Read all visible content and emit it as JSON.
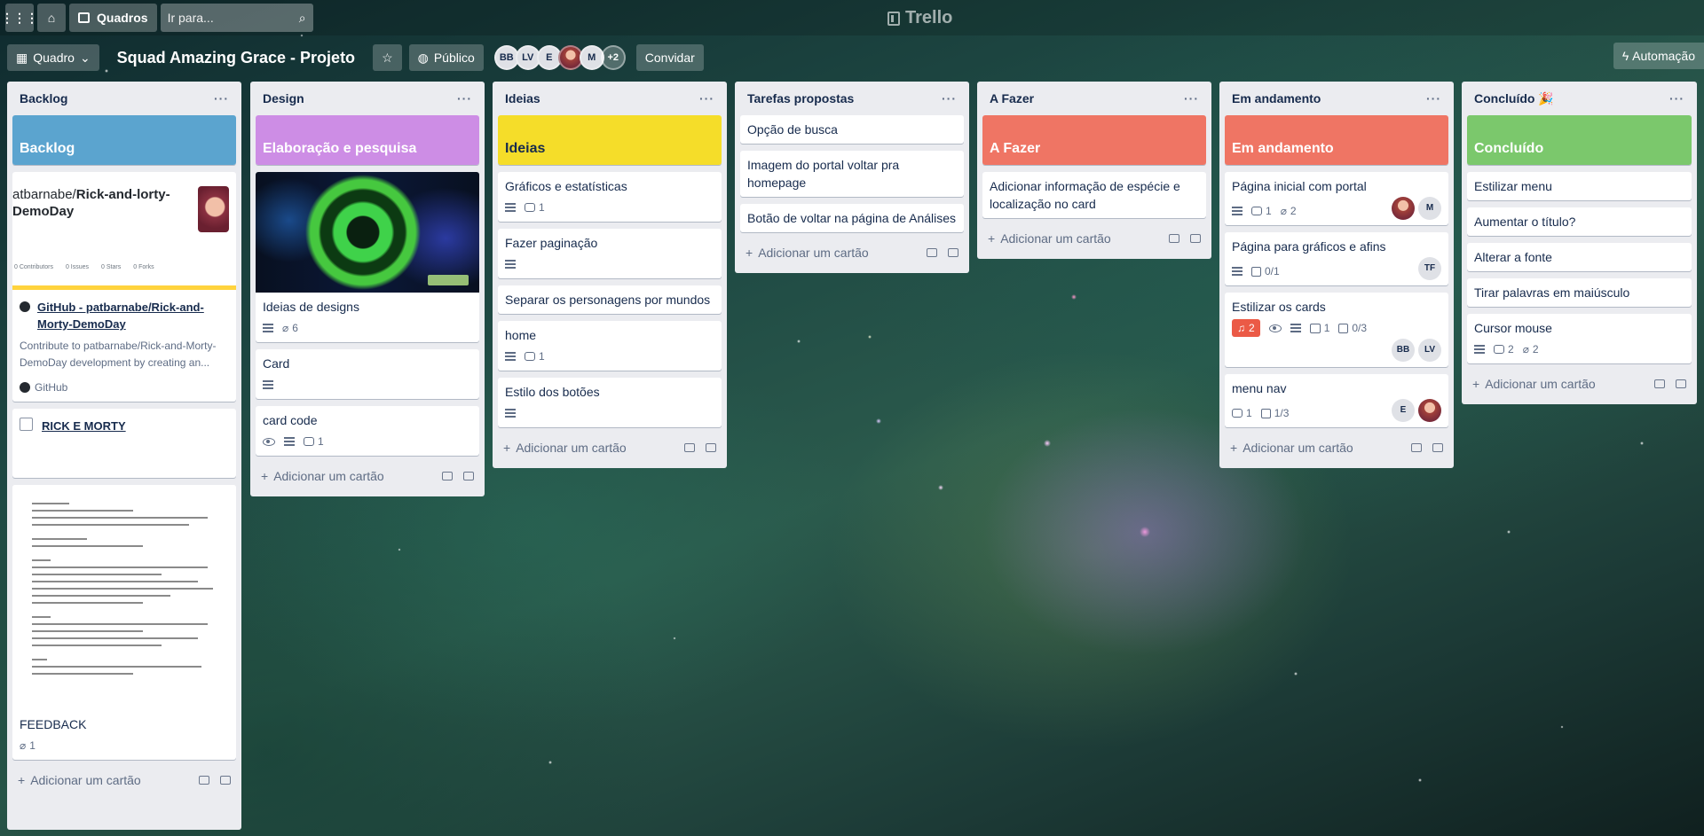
{
  "topnav": {
    "boards_label": "Quadros",
    "search_placeholder": "Ir para...",
    "logo": "Trello"
  },
  "board": {
    "view_label": "Quadro",
    "title": "Squad Amazing Grace - Projeto",
    "visibility": "Público",
    "members": [
      "BB",
      "LV",
      "E",
      "",
      "M"
    ],
    "extra_members": "+2",
    "invite_label": "Convidar",
    "automation_label": "Automação"
  },
  "add_card_label": "Adicionar um cartão",
  "lists": {
    "backlog": {
      "title": "Backlog",
      "cover_title": "Backlog",
      "github": {
        "title_prefix": "atbarnabe/",
        "title_bold": "Rick-and-lorty-DemoDay",
        "stats": [
          "0 Contributors",
          "0 Issues",
          "0 Stars",
          "0 Forks"
        ],
        "link": "GitHub - patbarnabe/Rick-and-Morty-DemoDay",
        "desc": "Contribute to patbarnabe/Rick-and-Morty-DemoDay development by creating an...",
        "source": "GitHub"
      },
      "rm_link": "RICK E MORTY",
      "feedback_title": "FEEDBACK",
      "feedback_attach": "1"
    },
    "design": {
      "title": "Design",
      "cover_title": "Elaboração e pesquisa",
      "cards": [
        {
          "title": "Ideias de designs",
          "attach": "6"
        },
        {
          "title": "Card"
        },
        {
          "title": "card code",
          "comments": "1"
        }
      ]
    },
    "ideias": {
      "title": "Ideias",
      "cover_title": "Ideias",
      "cards": [
        {
          "title": "Gráficos e estatísticas",
          "comments": "1"
        },
        {
          "title": "Fazer paginação"
        },
        {
          "title": "Separar os personagens por mundos"
        },
        {
          "title": "home",
          "comments": "1"
        },
        {
          "title": "Estilo dos botões"
        }
      ]
    },
    "tarefas": {
      "title": "Tarefas propostas",
      "cards": [
        {
          "title": "Opção de busca"
        },
        {
          "title": "Imagem do portal voltar pra homepage"
        },
        {
          "title": "Botão de voltar na página de Análises"
        }
      ]
    },
    "afazer": {
      "title": "A Fazer",
      "cover_title": "A Fazer",
      "cards": [
        {
          "title": "Adicionar informação de espécie e localização no card"
        }
      ]
    },
    "andamento": {
      "title": "Em andamento",
      "cover_title": "Em andamento",
      "cards": [
        {
          "title": "Página inicial com portal",
          "comments": "1",
          "attach": "2",
          "members": [
            "",
            "M"
          ]
        },
        {
          "title": "Página para gráficos e afins",
          "checklist": "0/1",
          "members": [
            "TF"
          ]
        },
        {
          "title": "Estilizar os cards",
          "notif": "2",
          "attach_card": "1",
          "checklist": "0/3",
          "members": [
            "BB",
            "LV"
          ]
        },
        {
          "title": "menu nav",
          "comments": "1",
          "checklist": "1/3",
          "members": [
            "E",
            ""
          ]
        }
      ]
    },
    "concluido": {
      "title": "Concluído 🎉",
      "cover_title": "Concluído",
      "cards": [
        {
          "title": "Estilizar menu"
        },
        {
          "title": "Aumentar o título?"
        },
        {
          "title": "Alterar a fonte"
        },
        {
          "title": "Tirar palavras em maiúsculo"
        },
        {
          "title": "Cursor mouse",
          "comments": "2",
          "attach": "2"
        }
      ]
    }
  },
  "colors": {
    "backlog_cover": "#5ba4cf",
    "design_cover": "#cd8de5",
    "ideias_cover": "#f5dd29",
    "afazer_cover": "#ef7564",
    "andamento_cover": "#ef7564",
    "concluido_cover": "#7bc86c"
  }
}
